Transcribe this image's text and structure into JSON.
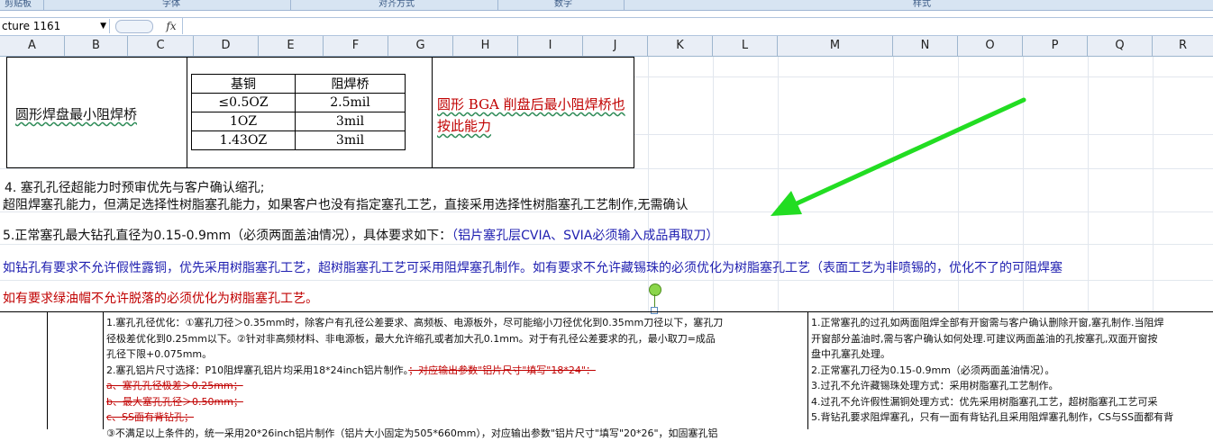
{
  "ribbon": {
    "groups": [
      "剪贴板",
      "字体",
      "对齐方式",
      "数字",
      "样式"
    ]
  },
  "formula_bar": {
    "name_box": "cture 1161",
    "fx_label": "fx"
  },
  "columns": [
    "A",
    "B",
    "C",
    "D",
    "E",
    "F",
    "G",
    "H",
    "I",
    "J",
    "K",
    "L",
    "M",
    "N",
    "O",
    "P",
    "Q",
    "R"
  ],
  "table_block": {
    "label": "圆形焊盘最小阻焊桥",
    "header": [
      "基铜",
      "阻焊桥"
    ],
    "rows": [
      [
        "≤0.5OZ",
        "2.5mil"
      ],
      [
        "1OZ",
        "3mil"
      ],
      [
        "1.43OZ",
        "3mil"
      ]
    ],
    "note": "圆形 BGA 削盘后最小阻焊桥也按此能力"
  },
  "paragraphs": {
    "p4_title": "4. 塞孔孔径超能力时预审优先与客户确认缩孔;",
    "p4_body": "超阻焊塞孔能力，但满足选择性树脂塞孔能力，如果客户也没有指定塞孔工艺，直接采用选择性树脂塞孔工艺制作,无需确认",
    "p5_main": "5.正常塞孔最大钻孔直径为0.15-0.9mm（必须两面盖油情况），具体要求如下：",
    "p5_blue": "（铝片塞孔层CVIA、SVIA必须输入成品再取刀）",
    "p6": "如钻孔有要求不允许假性露铜，优先采用树脂塞孔工艺，超树脂塞孔工艺可采用阻焊塞孔制作。如有要求不允许藏锡珠的必须优化为树脂塞孔工艺（表面工艺为非喷锡的，优化不了的可阻焊塞",
    "p7": "如有要求绿油帽不允许脱落的必须优化为树脂塞孔工艺。"
  },
  "bottom_left": {
    "lines": [
      "1.塞孔孔径优化：①塞孔刀径＞0.35mm时，除客户有孔径公差要求、高频板、电源板外，尽可能缩小刀径优化到0.35mm刀径以下，塞孔刀",
      "径极差优化到0.25mm以下。②针对非高频材料、非电源板，最大允许缩孔或者加大孔0.1mm。对于有孔径公差要求的孔，最小取刀=成品",
      "孔径下限+0.075mm。",
      "2.塞孔铝片尺寸选择：P10阻焊塞孔铝片均采用18*24inch铝片制作。"
    ],
    "struck_suffix": "；对应输出参数\"铝片尺寸\"填写\"18*24\"：",
    "struck_lines": [
      "a、塞孔孔径极差＞0.25mm；",
      "b、最大塞孔孔径＞0.50mm；",
      "c、SS面有背钻孔；"
    ],
    "last_line": "③不满足以上条件的，统一采用20*26inch铝片制作（铝片大小固定为505*660mm），对应输出参数\"铝片尺寸\"填写\"20*26\"，如固塞孔铝"
  },
  "bottom_right": {
    "lines": [
      "1.正常塞孔的过孔如两面阻焊全部有开窗需与客户确认删除开窗,塞孔制作.当阻焊",
      "开窗部分盖油时,需与客户确认如何处理.可建议两面盖油的孔按塞孔,双面开窗按",
      "盘中孔塞孔处理。",
      "2.正常塞孔刀径为0.15-0.9mm（必须两面盖油情况）。",
      "3.过孔不允许藏锡珠处理方式：采用树脂塞孔工艺制作。",
      "4.过孔不允许假性漏铜处理方式：优先采用树脂塞孔工艺，超树脂塞孔工艺可采",
      "5.背钻孔要求阻焊塞孔，只有一面有背钻孔且采用阻焊塞孔制作，CS与SS面都有背"
    ]
  },
  "colors": {
    "arrow": "#22dd22",
    "red_text": "#c00000",
    "blue_text": "#1f1fb0",
    "header_bg": "#e9eef6"
  }
}
